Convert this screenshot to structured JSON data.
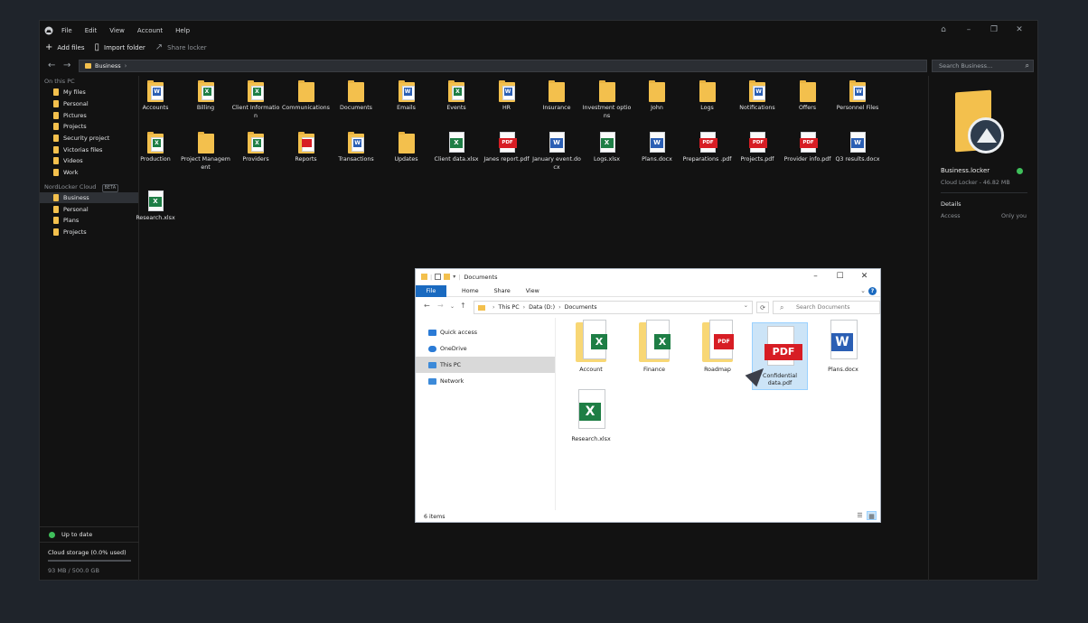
{
  "app": {
    "menu": [
      "File",
      "Edit",
      "View",
      "Account",
      "Help"
    ],
    "window_controls": [
      "lock-icon",
      "minimize-icon",
      "restore-icon",
      "close-icon"
    ],
    "window_glyphs": [
      "⌂",
      "–",
      "❐",
      "✕"
    ],
    "toolbar": {
      "add_files": "Add files",
      "import_folder": "Import folder",
      "share_locker": "Share locker"
    },
    "breadcrumb": "Business",
    "search_placeholder": "Search Business..."
  },
  "sidebar": {
    "pc_header": "On this PC",
    "pc_items": [
      "My files",
      "Personal",
      "Pictures",
      "Projects",
      "Security project",
      "Victorias files",
      "Videos",
      "Work"
    ],
    "cloud_header": "NordLocker Cloud",
    "cloud_badge": "BETA",
    "cloud_items": [
      "Business",
      "Personal",
      "Plans",
      "Projects"
    ],
    "active_cloud_item": "Business",
    "status": "Up to date",
    "storage_label": "Cloud storage (0.0% used)",
    "storage_used_fraction": 0.0,
    "storage_size": "93 MB / 500.0 GB"
  },
  "files": [
    {
      "name": "Accounts",
      "kind": "folder-word"
    },
    {
      "name": "Billing",
      "kind": "folder-excel"
    },
    {
      "name": "Client Information",
      "kind": "folder-excel"
    },
    {
      "name": "Communications",
      "kind": "folder"
    },
    {
      "name": "Documents",
      "kind": "folder"
    },
    {
      "name": "Emails",
      "kind": "folder-word"
    },
    {
      "name": "Events",
      "kind": "folder-excel"
    },
    {
      "name": "HR",
      "kind": "folder-word"
    },
    {
      "name": "Insurance",
      "kind": "folder"
    },
    {
      "name": "Investment options",
      "kind": "folder"
    },
    {
      "name": "John",
      "kind": "folder"
    },
    {
      "name": "Logs",
      "kind": "folder"
    },
    {
      "name": "Notifications",
      "kind": "folder-word"
    },
    {
      "name": "Offers",
      "kind": "folder"
    },
    {
      "name": "Personnel Files",
      "kind": "folder-word"
    },
    {
      "name": "Production",
      "kind": "folder-excel"
    },
    {
      "name": "Project Management",
      "kind": "folder"
    },
    {
      "name": "Providers",
      "kind": "folder-excel"
    },
    {
      "name": "Reports",
      "kind": "folder-pdf"
    },
    {
      "name": "Transactions",
      "kind": "folder-word"
    },
    {
      "name": "Updates",
      "kind": "folder"
    },
    {
      "name": "Client data.xlsx",
      "kind": "excel"
    },
    {
      "name": "Janes report.pdf",
      "kind": "pdf"
    },
    {
      "name": "January event.docx",
      "kind": "word"
    },
    {
      "name": "Logs.xlsx",
      "kind": "excel"
    },
    {
      "name": "Plans.docx",
      "kind": "word"
    },
    {
      "name": "Preparations .pdf",
      "kind": "pdf"
    },
    {
      "name": "Projects.pdf",
      "kind": "pdf"
    },
    {
      "name": "Provider info.pdf",
      "kind": "pdf"
    },
    {
      "name": "Q3 results.docx",
      "kind": "word"
    },
    {
      "name": "Research.xlsx",
      "kind": "excel"
    }
  ],
  "details": {
    "name": "Business.locker",
    "subtitle": "Cloud Locker - 46.82 MB",
    "section": "Details",
    "access_label": "Access",
    "access_value": "Only you"
  },
  "explorer": {
    "title": "Documents",
    "ribbon": {
      "file": "File",
      "tabs": [
        "Home",
        "Share",
        "View"
      ]
    },
    "path": [
      "This PC",
      "Data (D:)",
      "Documents"
    ],
    "search_placeholder": "Search Documents",
    "nav": [
      "Quick access",
      "OneDrive",
      "This PC",
      "Network"
    ],
    "active_nav": "This PC",
    "items": [
      {
        "name": "Account",
        "kind": "folder-excel"
      },
      {
        "name": "Finance",
        "kind": "folder-excel"
      },
      {
        "name": "Roadmap",
        "kind": "folder-pdf"
      },
      {
        "name": "Confidential data.pdf",
        "kind": "pdf"
      },
      {
        "name": "Plans.docx",
        "kind": "word"
      },
      {
        "name": "Research.xlsx",
        "kind": "excel"
      }
    ],
    "selected_item": "Confidential data.pdf",
    "status": "6 items"
  },
  "colors": {
    "excel": "#1e7e45",
    "word": "#2b5fb4",
    "pdf": "#d71d24",
    "folder": "#f3c04d",
    "accent": "#1a6ac0",
    "ok": "#3fbf5b"
  }
}
